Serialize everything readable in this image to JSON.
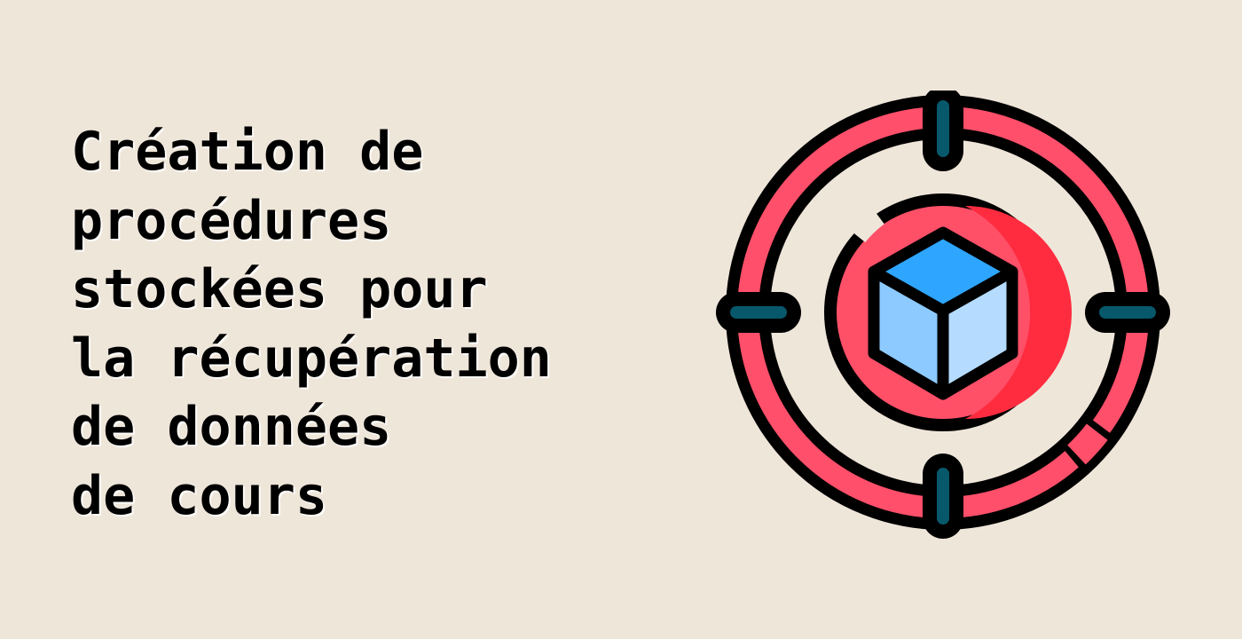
{
  "page": {
    "background": "#efe6da"
  },
  "title": {
    "lines": [
      "Création de",
      "procédures",
      "stockées pour",
      "la récupération",
      "de données",
      "de cours"
    ]
  },
  "illustration": {
    "icon": "target-crosshair-cube-icon",
    "colors": {
      "ring": "#ff4f6a",
      "inner_disc": "#ff5068",
      "inner_disc_shade": "#ff2c40",
      "cube_top": "#2ea6ff",
      "cube_left": "#8dcaff",
      "cube_right": "#b5dcff",
      "tick": "#08586b",
      "outline": "#000000"
    }
  }
}
